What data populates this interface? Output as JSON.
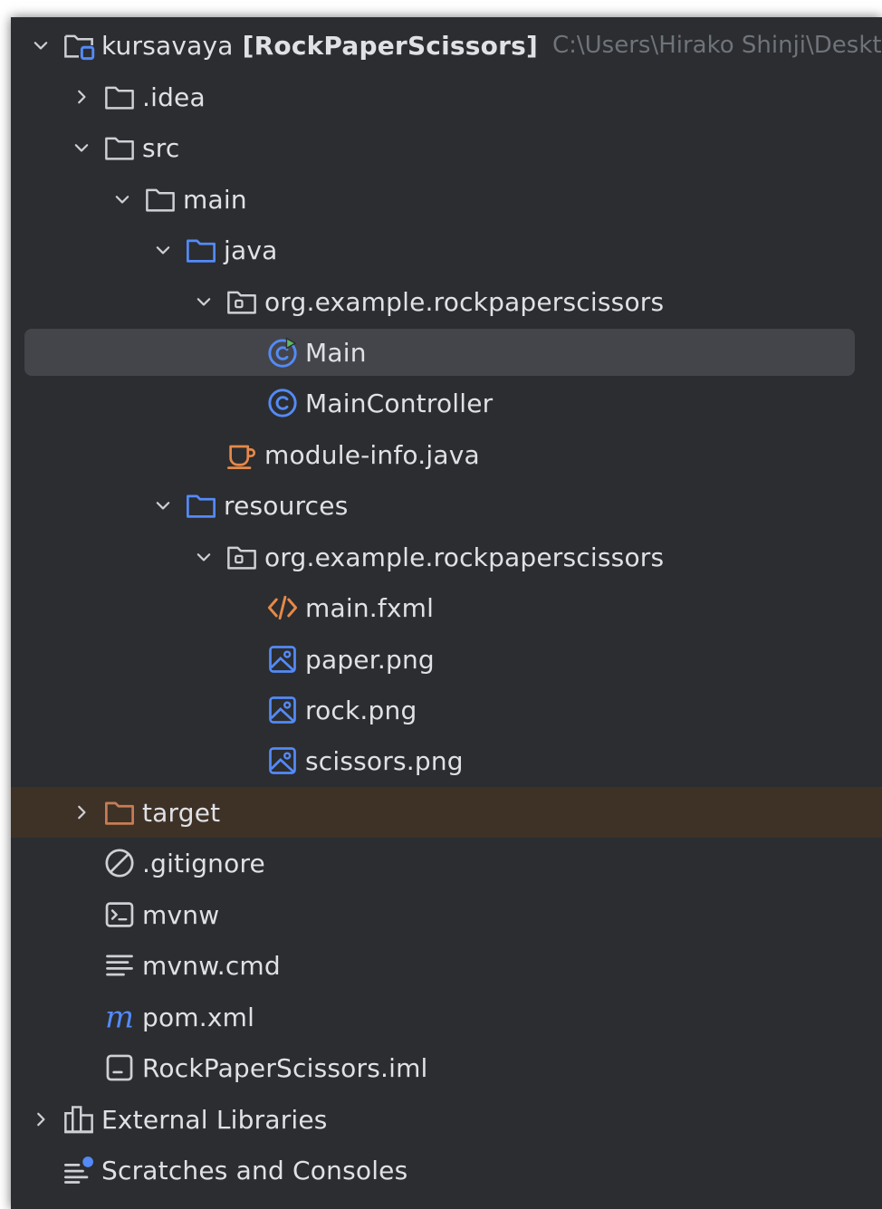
{
  "tree": {
    "project": {
      "name": "kursavaya",
      "module": "[RockPaperScissors]",
      "path": "C:\\Users\\Hirako Shinji\\Desktop"
    },
    "idea": ".idea",
    "src": "src",
    "main": "main",
    "java": "java",
    "java_package": "org.example.rockpaperscissors",
    "main_class": "Main",
    "main_controller": "MainController",
    "module_info": "module-info.java",
    "resources": "resources",
    "resources_package": "org.example.rockpaperscissors",
    "main_fxml": "main.fxml",
    "paper_png": "paper.png",
    "rock_png": "rock.png",
    "scissors_png": "scissors.png",
    "target": "target",
    "gitignore": ".gitignore",
    "mvnw": "mvnw",
    "mvnw_cmd": "mvnw.cmd",
    "pom_xml": "pom.xml",
    "iml": "RockPaperScissors.iml",
    "external_libraries": "External Libraries",
    "scratches": "Scratches and Consoles"
  },
  "colors": {
    "panel_bg": "#2b2d30",
    "selection_bg": "#43454a",
    "excluded_bg": "#3e3126",
    "text": "#dfe1e5",
    "muted_text": "#6f737a",
    "folder_blue": "#548af7",
    "folder_gray": "#ced0d6",
    "folder_orange": "#c77d55",
    "java_orange": "#e6894a",
    "run_green": "#5fb865"
  }
}
